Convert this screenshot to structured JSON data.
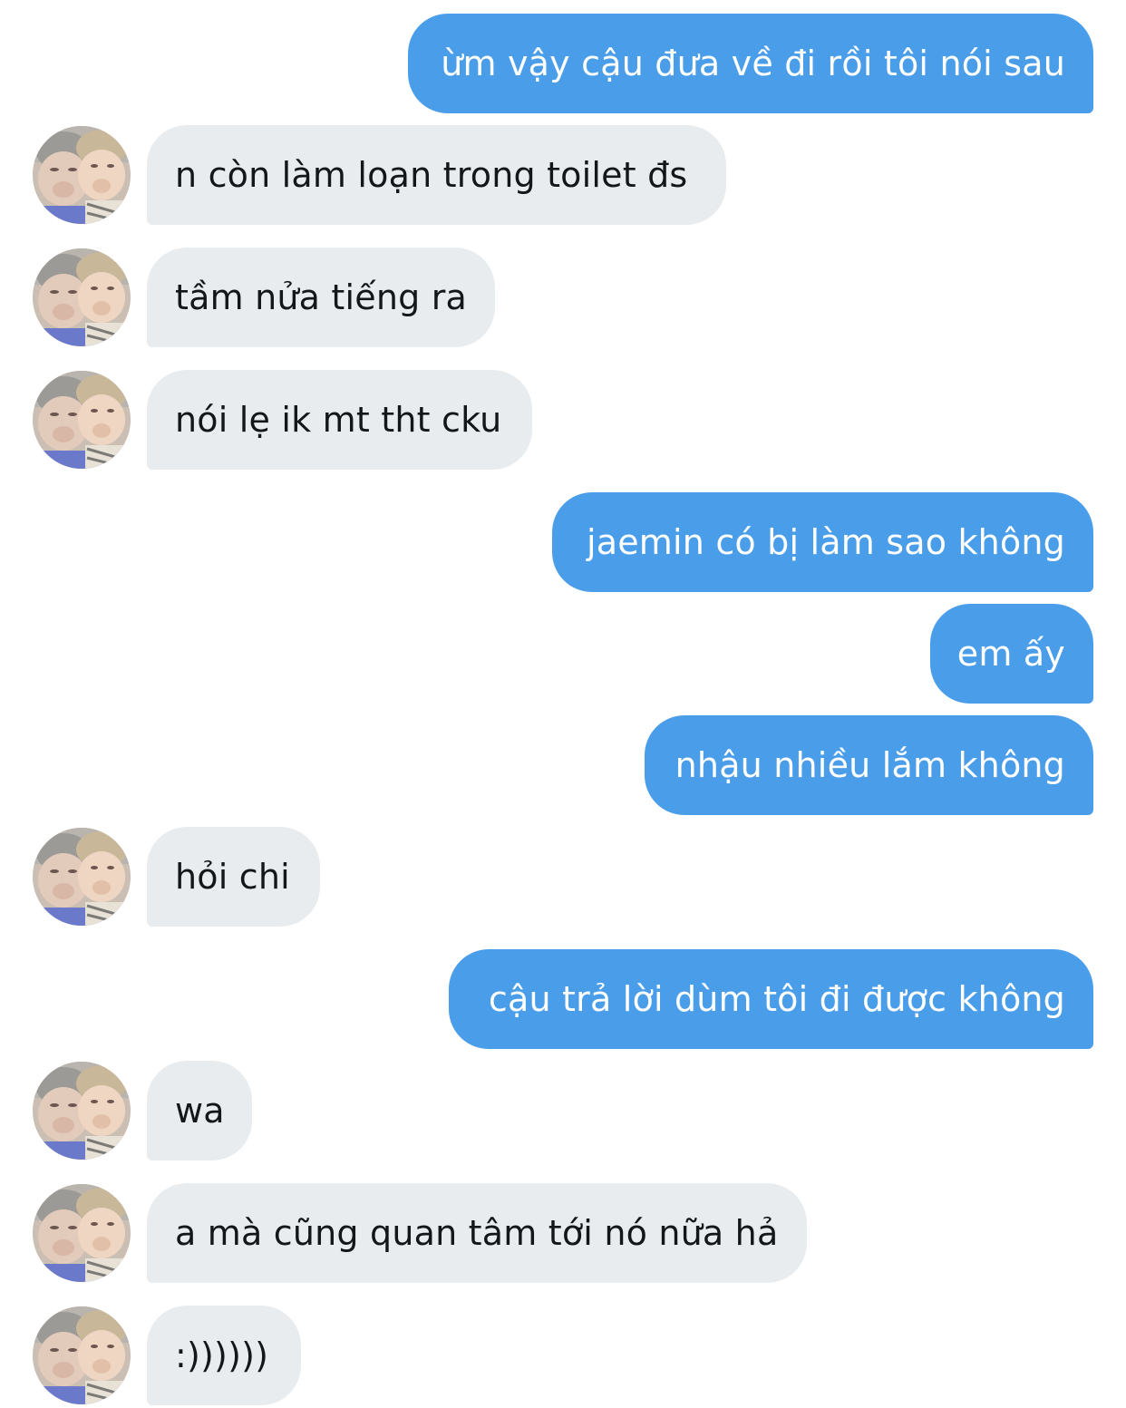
{
  "conversation": {
    "messages": [
      {
        "direction": "sent",
        "text": "ừm vậy cậu đưa về đi rồi tôi nói sau"
      },
      {
        "direction": "received",
        "text": "n còn làm loạn trong toilet đs",
        "avatar": "contact-avatar"
      },
      {
        "direction": "received",
        "text": "tầm nửa tiếng ra",
        "avatar": "contact-avatar"
      },
      {
        "direction": "received",
        "text": "nói lẹ ik mt tht cku",
        "avatar": "contact-avatar"
      },
      {
        "direction": "sent",
        "text": "jaemin có bị làm sao không"
      },
      {
        "direction": "sent",
        "text": "em ấy"
      },
      {
        "direction": "sent",
        "text": "nhậu nhiều lắm không"
      },
      {
        "direction": "received",
        "text": "hỏi chi",
        "avatar": "contact-avatar"
      },
      {
        "direction": "sent",
        "text": "cậu trả lời dùm tôi đi được không"
      },
      {
        "direction": "received",
        "text": "wa",
        "avatar": "contact-avatar"
      },
      {
        "direction": "received",
        "text": "a mà cũng quan tâm tới nó nữa hả",
        "avatar": "contact-avatar"
      },
      {
        "direction": "received",
        "text": ":))))))",
        "avatar": "contact-avatar"
      }
    ]
  },
  "colors": {
    "sent_bubble": "#4a9de9",
    "received_bubble": "#e9ecef",
    "sent_text": "#ffffff",
    "received_text": "#14171a",
    "background": "#ffffff"
  }
}
